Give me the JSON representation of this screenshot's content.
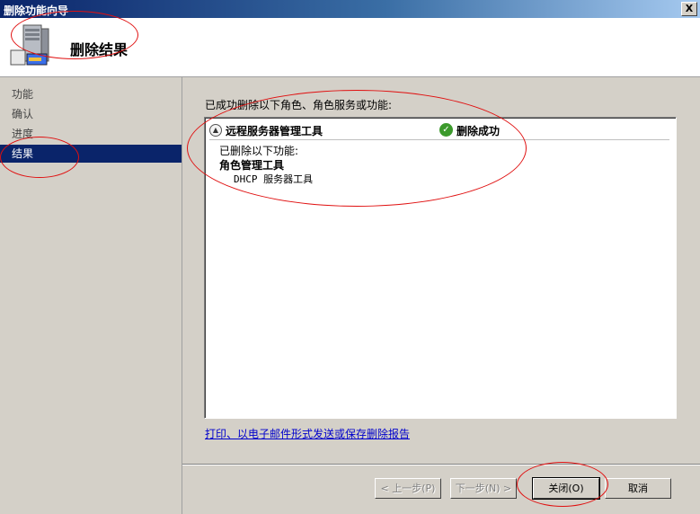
{
  "window": {
    "title": "删除功能向导",
    "close_label": "X"
  },
  "header": {
    "page_title": "删除结果"
  },
  "sidebar": {
    "items": [
      {
        "label": "功能"
      },
      {
        "label": "确认"
      },
      {
        "label": "进度"
      },
      {
        "label": "结果"
      }
    ],
    "active_index": 3
  },
  "main": {
    "intro": "已成功删除以下角色、角色服务或功能:",
    "result": {
      "feature_name": "远程服务器管理工具",
      "status": "删除成功",
      "removed_label": "已删除以下功能:",
      "group_name": "角色管理工具",
      "sub_item": "DHCP 服务器工具"
    },
    "report_link": "打印、以电子邮件形式发送或保存删除报告"
  },
  "buttons": {
    "prev": "< 上一步(P)",
    "next": "下一步(N) >",
    "close": "关闭(O)",
    "cancel": "取消"
  },
  "colors": {
    "selection": "#0a246a",
    "success": "#3c9a2c",
    "link": "#0000cc",
    "annotation": "#e01010"
  }
}
